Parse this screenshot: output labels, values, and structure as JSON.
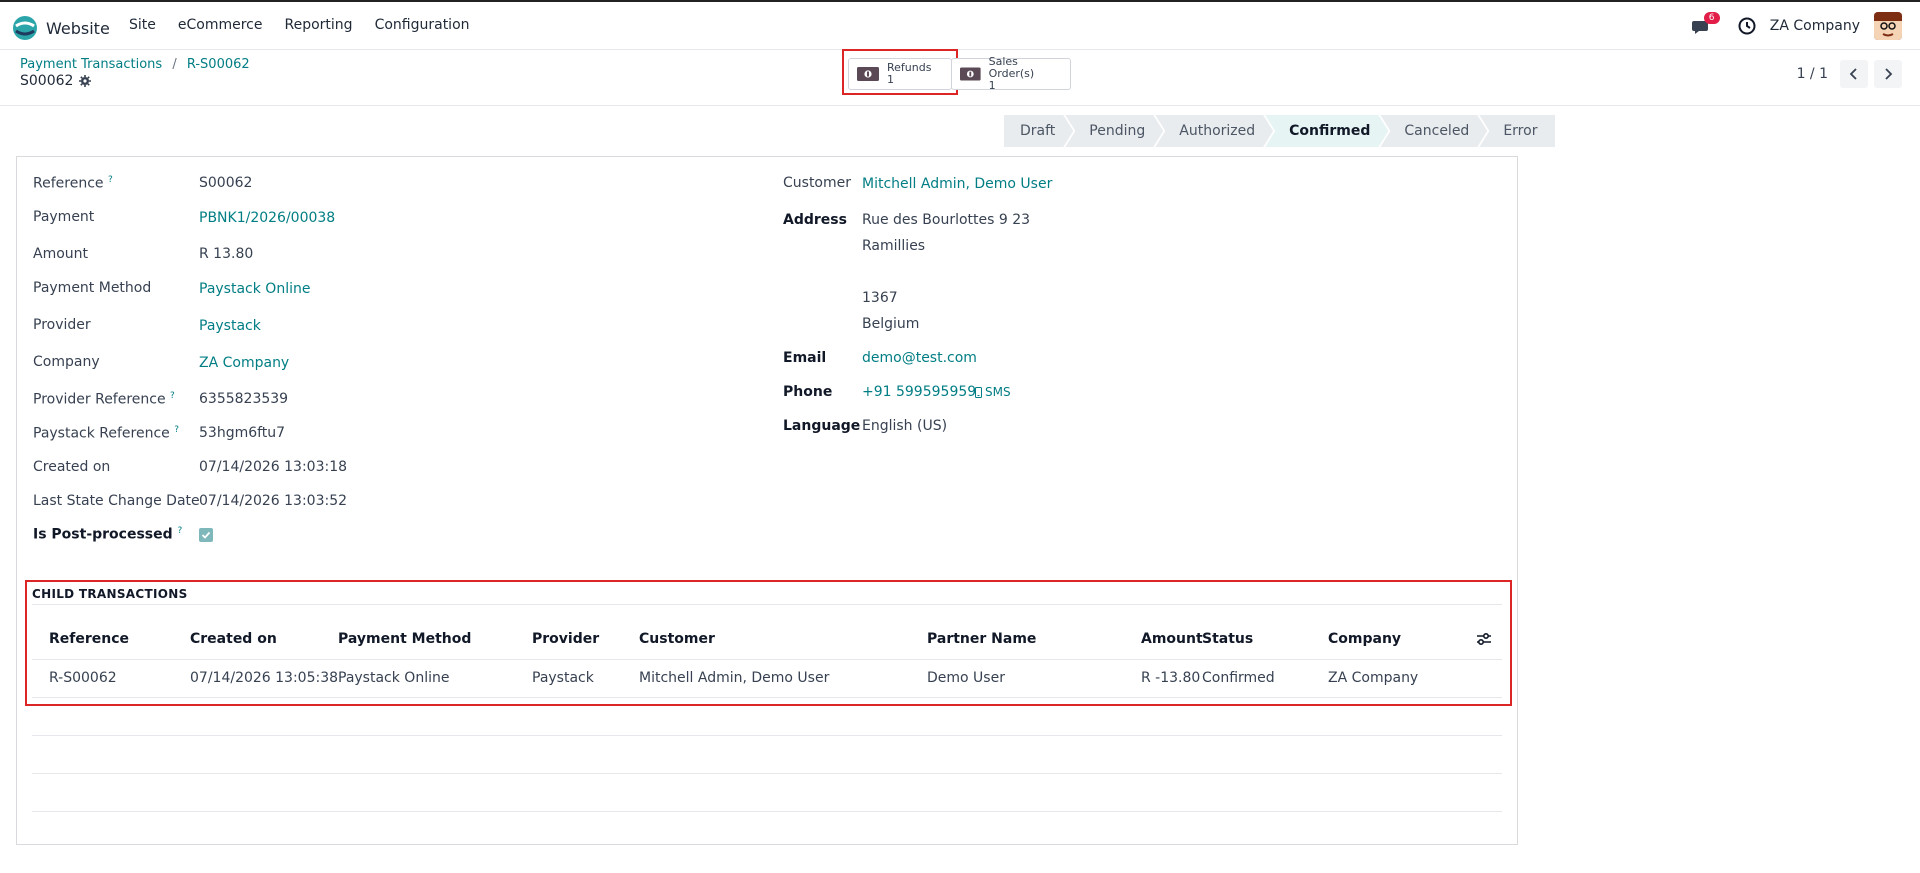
{
  "nav": {
    "app_name": "Website",
    "menu": [
      "Site",
      "eCommerce",
      "Reporting",
      "Configuration"
    ],
    "chat_count": "6",
    "company": "ZA Company"
  },
  "control": {
    "breadcrumb": [
      "Payment Transactions",
      "R-S00062"
    ],
    "breadcrumb_sep": "/",
    "record_name": "S00062",
    "smart_buttons": [
      {
        "label": "Refunds",
        "count": "1"
      },
      {
        "label": "Sales Order(s)",
        "count": "1"
      }
    ],
    "pager": "1 / 1"
  },
  "statusbar": {
    "stages": [
      "Draft",
      "Pending",
      "Authorized",
      "Confirmed",
      "Canceled",
      "Error"
    ],
    "active": "Confirmed"
  },
  "left_fields": {
    "reference": {
      "label": "Reference",
      "value": "S00062"
    },
    "payment": {
      "label": "Payment",
      "value": "PBNK1/2026/00038"
    },
    "amount": {
      "label": "Amount",
      "value": "R 13.80"
    },
    "payment_method": {
      "label": "Payment Method",
      "value": "Paystack Online"
    },
    "provider": {
      "label": "Provider",
      "value": "Paystack"
    },
    "company": {
      "label": "Company",
      "value": "ZA Company"
    },
    "provider_reference": {
      "label": "Provider Reference",
      "value": "6355823539"
    },
    "paystack_reference": {
      "label": "Paystack Reference",
      "value": "53hgm6ftu7"
    },
    "created_on": {
      "label": "Created on",
      "value": "07/14/2026 13:03:18"
    },
    "last_state_change": {
      "label": "Last State Change Date",
      "value": "07/14/2026 13:03:52"
    },
    "post_processed": {
      "label": "Is Post-processed",
      "checked": true
    },
    "help_mark": "?"
  },
  "right_fields": {
    "customer": {
      "label": "Customer",
      "value": "Mitchell Admin, Demo User"
    },
    "address": {
      "label": "Address",
      "lines": [
        "Rue des Bourlottes 9 23",
        "Ramillies",
        "1367",
        "Belgium"
      ]
    },
    "email": {
      "label": "Email",
      "value": "demo@test.com"
    },
    "phone": {
      "label": "Phone",
      "value": "+91 599595959",
      "sms": "SMS"
    },
    "language": {
      "label": "Language",
      "value": "English (US)"
    }
  },
  "child_transactions": {
    "title": "CHILD TRANSACTIONS",
    "columns": [
      "Reference",
      "Created on",
      "Payment Method",
      "Provider",
      "Customer",
      "Partner Name",
      "Amount",
      "Status",
      "Company"
    ],
    "rows": [
      [
        "R-S00062",
        "07/14/2026 13:05:38",
        "Paystack Online",
        "Paystack",
        "Mitchell Admin, Demo User",
        "Demo User",
        "R -13.80",
        "Confirmed",
        "ZA Company"
      ]
    ]
  },
  "colors": {
    "accent": "#017e84",
    "highlight": "#dc2626"
  }
}
